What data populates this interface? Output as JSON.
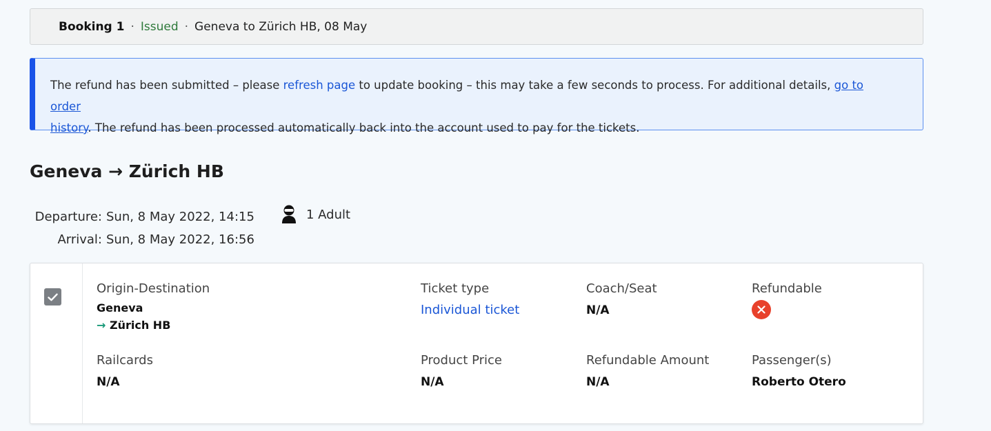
{
  "booking": {
    "title": "Booking 1",
    "separator": "·",
    "status": "Issued",
    "route": "Geneva to Zürich HB, 08 May"
  },
  "alert": {
    "text_1": "The refund has been submitted – please ",
    "link_refresh": "refresh page",
    "text_2": " to update booking – this may take a few seconds to process. For additional details, ",
    "link_history_1": "go to order",
    "link_history_2": "history",
    "text_3": ". The refund has been processed automatically back into the account used to pay for the tickets."
  },
  "journey": {
    "title": "Geneva → Zürich HB",
    "departure_label": "Departure:",
    "departure_value": "Sun, 8 May 2022, 14:15",
    "arrival_label": "Arrival:",
    "arrival_value": "Sun, 8 May 2022, 16:56",
    "passengers": "1 Adult"
  },
  "ticket": {
    "selected": true,
    "origin_destination_label": "Origin-Destination",
    "origin": "Geneva",
    "destination_arrow": "→",
    "destination": "Zürich HB",
    "ticket_type_label": "Ticket type",
    "ticket_type_value": "Individual ticket",
    "coach_seat_label": "Coach/Seat",
    "coach_seat_value": "N/A",
    "refundable_label": "Refundable",
    "refundable_icon": "close-circle-icon",
    "railcards_label": "Railcards",
    "railcards_value": "N/A",
    "product_price_label": "Product Price",
    "product_price_value": "N/A",
    "refundable_amount_label": "Refundable Amount",
    "refundable_amount_value": "N/A",
    "passengers_label": "Passenger(s)",
    "passengers_value": "Roberto Otero"
  },
  "colors": {
    "issued": "#2f7a3b",
    "link": "#1a56d6",
    "alert_accent": "#1a53e8",
    "refund_no": "#e8412b",
    "arrow": "#1a9a7a"
  }
}
